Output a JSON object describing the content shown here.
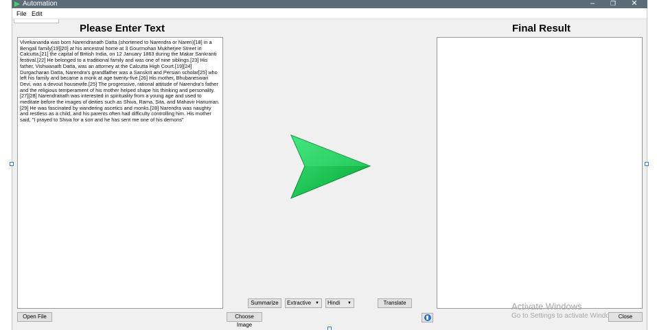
{
  "window": {
    "title": "Automation",
    "minimize": "–",
    "restore": "❐",
    "close": "✕"
  },
  "menu": {
    "file": "File",
    "edit": "Edit"
  },
  "left_panel": {
    "heading": "Please Enter Text",
    "text": "Vivekananda was born Narendranath Datta (shortened to Narendra or Naren)[18] in a Bengali family[19][20] at his ancestral home at 3 Gourmohan Mukherjee Street in Calcutta,[21] the capital of British India, on 12 January 1863 during the Makar Sankranti festival.[22] He belonged to a traditional family and was one of nine siblings.[23] His father, Vishwanath Datta, was an attorney at the Calcutta High Court.[19][24] Durgacharan Datta, Narendra's grandfather was a Sanskrit and Persian scholar[25] who left his family and became a monk at age twenty-five.[26] His mother, Bhubaneswari Devi, was a devout housewife.[25] The progressive, rational attitude of Narendra's father and the religious temperament of his mother helped shape his thinking and personality.[27][28] Narendranath was interested in spirituality from a young age and used to meditate before the images of deities such as Shiva, Rama, Sita, and Mahavir Hanuman.[29] He was fascinated by wandering ascetics and monks.[28] Narendra was naughty and restless as a child, and his parents often had difficulty controlling him. His mother said, \"I prayed to Shiva for a son and he has sent me one of his demons\"",
    "open_file": "Open File"
  },
  "right_panel": {
    "heading": "Final Result",
    "text": "",
    "close": "Close"
  },
  "controls": {
    "summarize": "Summarize",
    "summary_type": "Extractive",
    "language": "Hindi",
    "translate": "Translate",
    "choose_image": "Choose Image",
    "arrow_icon": "green-play-arrow",
    "speaker_icon": "speaker-icon"
  },
  "watermark": {
    "title": "Activate Windows",
    "subtitle": "Go to Settings to activate Windows."
  },
  "colors": {
    "titlebar": "#5b6b78",
    "arrow": "#22c55e",
    "window_bg": "#f0f0f0"
  }
}
